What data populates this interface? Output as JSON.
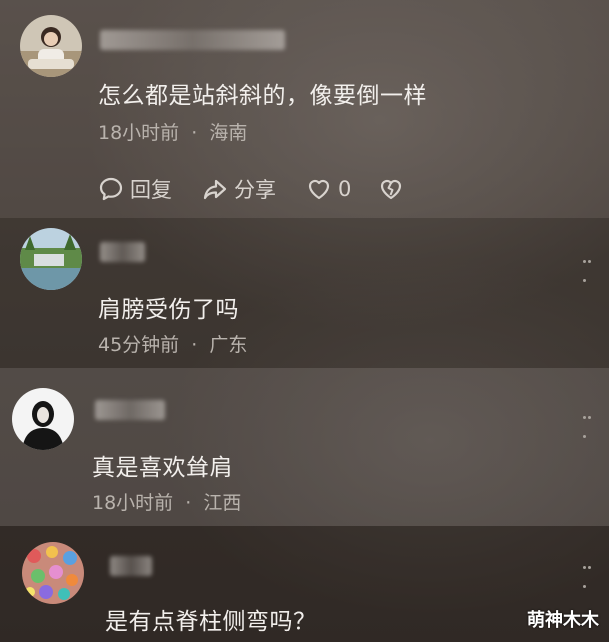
{
  "comments": [
    {
      "text": "怎么都是站斜斜的，像要倒一样",
      "time": "18小时前",
      "location": "海南",
      "actions": {
        "reply_label": "回复",
        "share_label": "分享",
        "like_count": "0"
      }
    },
    {
      "text": "肩膀受伤了吗",
      "time": "45分钟前",
      "location": "广东"
    },
    {
      "text": "真是喜欢耸肩",
      "time": "18小时前",
      "location": "江西"
    },
    {
      "text": "是有点脊柱侧弯吗？"
    }
  ],
  "meta_separator": "·",
  "watermark": "萌神木木",
  "icons": {
    "reply": "comment-bubble-icon",
    "share": "share-arrow-icon",
    "like": "heart-icon",
    "dislike": "broken-heart-icon",
    "more": "more-dots-icon"
  }
}
